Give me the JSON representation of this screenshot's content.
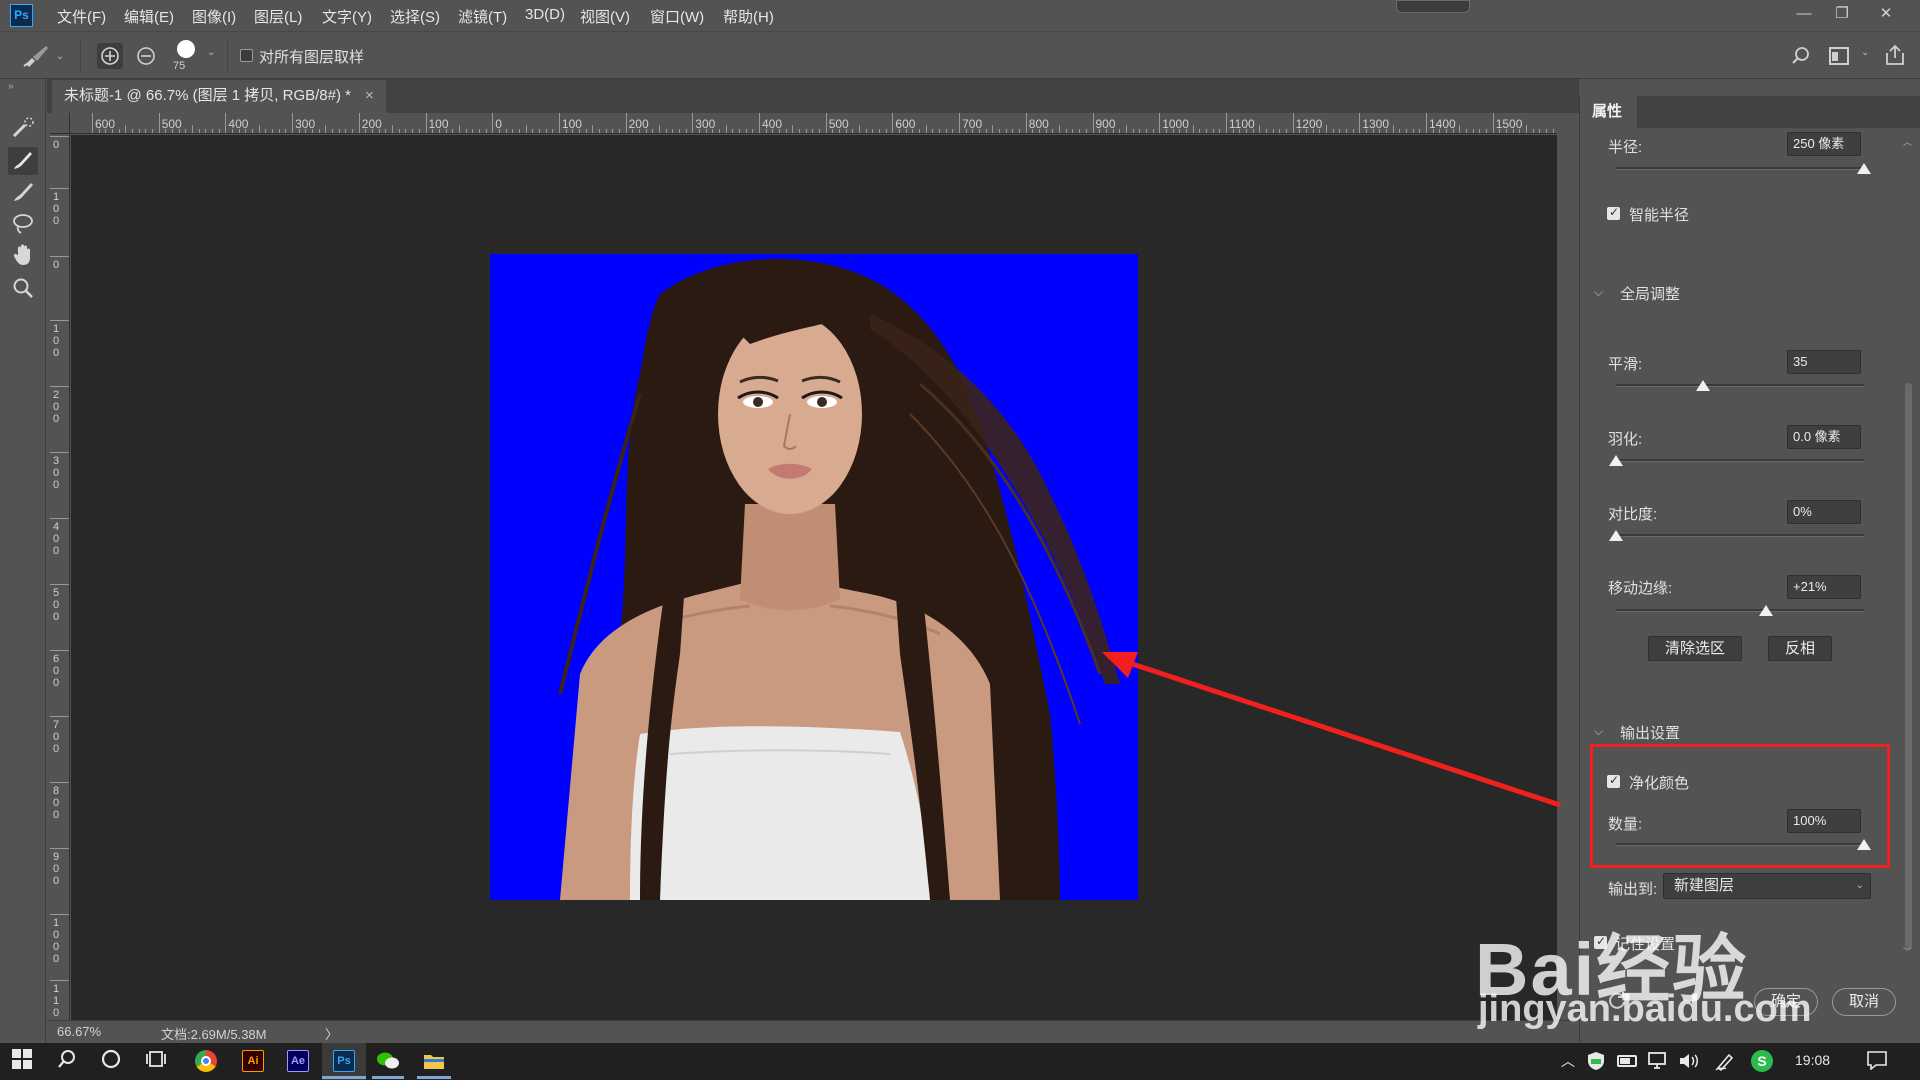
{
  "app": {
    "logo": "Ps",
    "name": "Adobe Photoshop"
  },
  "menu": [
    "文件(F)",
    "编辑(E)",
    "图像(I)",
    "图层(L)",
    "文字(Y)",
    "选择(S)",
    "滤镜(T)",
    "3D(D)",
    "视图(V)",
    "窗口(W)",
    "帮助(H)"
  ],
  "window_controls": {
    "minimize": "—",
    "restore": "❐",
    "close": "✕"
  },
  "options": {
    "brush_size": "75",
    "sample_all_layers_label": "对所有图层取样",
    "sample_all_layers_checked": false
  },
  "document": {
    "tab_title": "未标题-1 @ 66.7% (图层 1 拷贝, RGB/8#) *",
    "close_glyph": "×",
    "ruler_labels": [
      "600",
      "500",
      "400",
      "300",
      "200",
      "100",
      "0",
      "100",
      "200",
      "300",
      "400",
      "500",
      "600",
      "700",
      "800",
      "900",
      "1000",
      "1100",
      "1200",
      "1300",
      "1400",
      "1500"
    ],
    "vruler_labels": [
      "0",
      "100",
      "0",
      "100",
      "200",
      "300",
      "400",
      "500",
      "600",
      "700",
      "800",
      "900",
      "1000",
      "1100"
    ],
    "background_color": "#0000ff"
  },
  "status": {
    "zoom": "66.67%",
    "doc_info": "文档:2.69M/5.38M",
    "arrow": "〉"
  },
  "properties_panel": {
    "tab": "属性",
    "radius_label": "半径:",
    "radius_value": "250 像素",
    "radius_level": 1.0,
    "smart_radius_label": "智能半径",
    "smart_radius_checked": true,
    "global_section": "全局调整",
    "smooth_label": "平滑:",
    "smooth_value": "35",
    "smooth_level": 0.35,
    "feather_label": "羽化:",
    "feather_value": "0.0 像素",
    "feather_level": 0,
    "contrast_label": "对比度:",
    "contrast_value": "0%",
    "contrast_level": 0,
    "shift_edge_label": "移动边缘:",
    "shift_edge_value": "+21%",
    "shift_edge_level": 0.605,
    "clear_selection_button": "清除选区",
    "invert_button": "反相",
    "output_section": "输出设置",
    "decontaminate_label": "净化颜色",
    "decontaminate_checked": true,
    "amount_label": "数量:",
    "amount_value": "100%",
    "amount_level": 1.0,
    "output_to_label": "输出到:",
    "output_to_value": "新建图层",
    "remember_label": "记住设置",
    "remember_checked": true,
    "ok_button": "确定",
    "cancel_button": "取消"
  },
  "annotation": {
    "highlight_color": "#f21f1f",
    "arrow_color": "#f21f1f"
  },
  "watermark": {
    "line1": "Bai经验",
    "line2": "jingyan.baidu.com"
  },
  "taskbar": {
    "time": "19:08",
    "apps": [
      "Ai",
      "Ae",
      "Ps"
    ]
  }
}
